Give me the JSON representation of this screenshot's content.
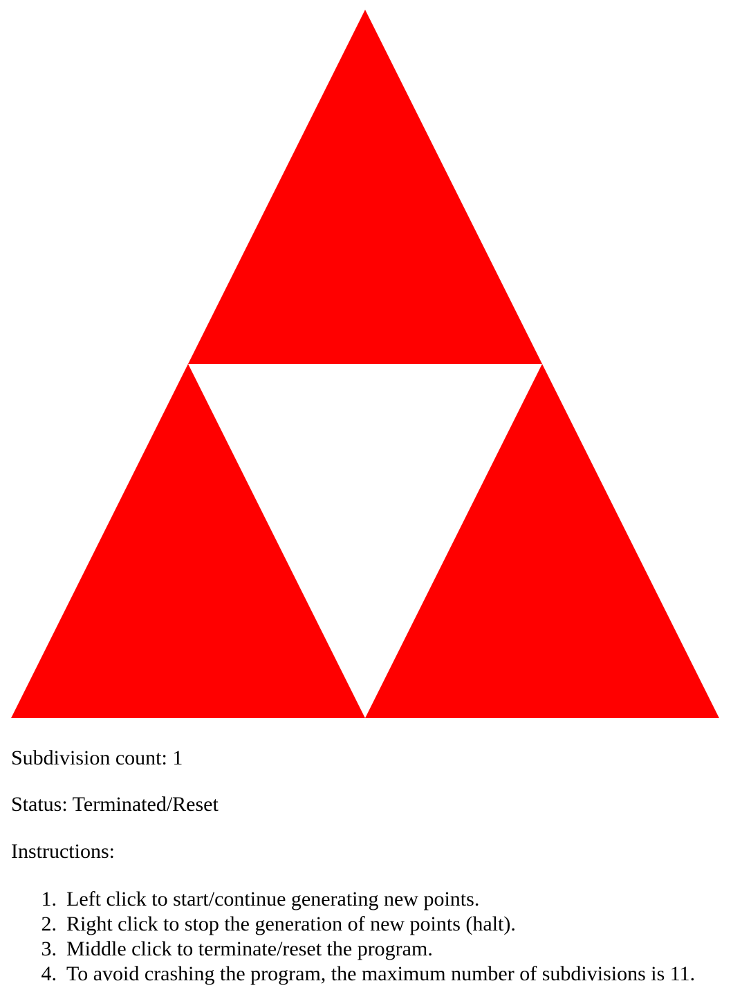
{
  "canvas": {
    "fill_color": "#ff0000",
    "background_color": "#ffffff",
    "subdivision_level": 1
  },
  "count_line": {
    "label": "Subdivision count:",
    "value": "1"
  },
  "status_line": {
    "label": "Status:",
    "value": "Terminated/Reset"
  },
  "instructions": {
    "heading": "Instructions:",
    "items": [
      {
        "number": "1.",
        "text": "Left click to start/continue generating new points."
      },
      {
        "number": "2.",
        "text": "Right click to stop the generation of new points (halt)."
      },
      {
        "number": "3.",
        "text": "Middle click to terminate/reset the program."
      },
      {
        "number": "4.",
        "text": "To avoid crashing the program, the maximum number of subdivisions is 11."
      }
    ]
  }
}
